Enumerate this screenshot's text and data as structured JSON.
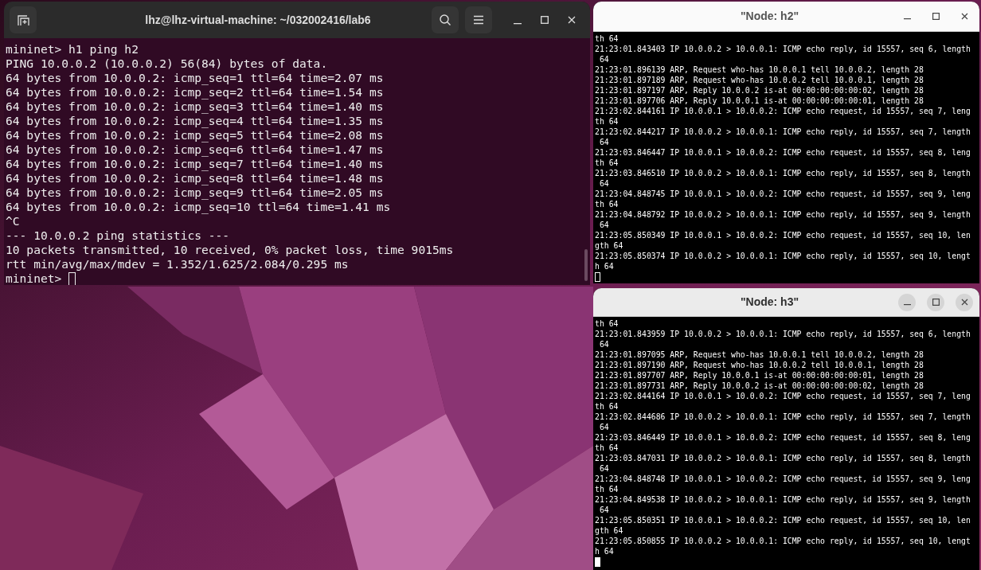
{
  "terminal": {
    "title": "lhz@lhz-virtual-machine: ~/032002416/lab6",
    "lines": [
      "mininet> h1 ping h2",
      "PING 10.0.0.2 (10.0.0.2) 56(84) bytes of data.",
      "64 bytes from 10.0.0.2: icmp_seq=1 ttl=64 time=2.07 ms",
      "64 bytes from 10.0.0.2: icmp_seq=2 ttl=64 time=1.54 ms",
      "64 bytes from 10.0.0.2: icmp_seq=3 ttl=64 time=1.40 ms",
      "64 bytes from 10.0.0.2: icmp_seq=4 ttl=64 time=1.35 ms",
      "64 bytes from 10.0.0.2: icmp_seq=5 ttl=64 time=2.08 ms",
      "64 bytes from 10.0.0.2: icmp_seq=6 ttl=64 time=1.47 ms",
      "64 bytes from 10.0.0.2: icmp_seq=7 ttl=64 time=1.40 ms",
      "64 bytes from 10.0.0.2: icmp_seq=8 ttl=64 time=1.48 ms",
      "64 bytes from 10.0.0.2: icmp_seq=9 ttl=64 time=2.05 ms",
      "64 bytes from 10.0.0.2: icmp_seq=10 ttl=64 time=1.41 ms",
      "^C",
      "--- 10.0.0.2 ping statistics ---",
      "10 packets transmitted, 10 received, 0% packet loss, time 9015ms",
      "rtt min/avg/max/mdev = 1.352/1.625/2.084/0.295 ms"
    ],
    "prompt": "mininet>"
  },
  "nodes": [
    {
      "title": "\"Node: h2\"",
      "focused": false,
      "lines": [
        "th 64",
        "21:23:01.843403 IP 10.0.0.2 > 10.0.0.1: ICMP echo reply, id 15557, seq 6, length",
        " 64",
        "21:23:01.896139 ARP, Request who-has 10.0.0.1 tell 10.0.0.2, length 28",
        "21:23:01.897189 ARP, Request who-has 10.0.0.2 tell 10.0.0.1, length 28",
        "21:23:01.897197 ARP, Reply 10.0.0.2 is-at 00:00:00:00:00:02, length 28",
        "21:23:01.897706 ARP, Reply 10.0.0.1 is-at 00:00:00:00:00:01, length 28",
        "21:23:02.844161 IP 10.0.0.1 > 10.0.0.2: ICMP echo request, id 15557, seq 7, leng",
        "th 64",
        "21:23:02.844217 IP 10.0.0.2 > 10.0.0.1: ICMP echo reply, id 15557, seq 7, length",
        " 64",
        "21:23:03.846447 IP 10.0.0.1 > 10.0.0.2: ICMP echo request, id 15557, seq 8, leng",
        "th 64",
        "21:23:03.846510 IP 10.0.0.2 > 10.0.0.1: ICMP echo reply, id 15557, seq 8, length",
        " 64",
        "21:23:04.848745 IP 10.0.0.1 > 10.0.0.2: ICMP echo request, id 15557, seq 9, leng",
        "th 64",
        "21:23:04.848792 IP 10.0.0.2 > 10.0.0.1: ICMP echo reply, id 15557, seq 9, length",
        " 64",
        "21:23:05.850349 IP 10.0.0.1 > 10.0.0.2: ICMP echo request, id 15557, seq 10, len",
        "gth 64",
        "21:23:05.850374 IP 10.0.0.2 > 10.0.0.1: ICMP echo reply, id 15557, seq 10, lengt",
        "h 64"
      ]
    },
    {
      "title": "\"Node: h3\"",
      "focused": true,
      "lines": [
        "th 64",
        "21:23:01.843959 IP 10.0.0.2 > 10.0.0.1: ICMP echo reply, id 15557, seq 6, length",
        " 64",
        "21:23:01.897095 ARP, Request who-has 10.0.0.1 tell 10.0.0.2, length 28",
        "21:23:01.897190 ARP, Request who-has 10.0.0.2 tell 10.0.0.1, length 28",
        "21:23:01.897707 ARP, Reply 10.0.0.1 is-at 00:00:00:00:00:01, length 28",
        "21:23:01.897731 ARP, Reply 10.0.0.2 is-at 00:00:00:00:00:02, length 28",
        "21:23:02.844164 IP 10.0.0.1 > 10.0.0.2: ICMP echo request, id 15557, seq 7, leng",
        "th 64",
        "21:23:02.844686 IP 10.0.0.2 > 10.0.0.1: ICMP echo reply, id 15557, seq 7, length",
        " 64",
        "21:23:03.846449 IP 10.0.0.1 > 10.0.0.2: ICMP echo request, id 15557, seq 8, leng",
        "th 64",
        "21:23:03.847031 IP 10.0.0.2 > 10.0.0.1: ICMP echo reply, id 15557, seq 8, length",
        " 64",
        "21:23:04.848748 IP 10.0.0.1 > 10.0.0.2: ICMP echo request, id 15557, seq 9, leng",
        "th 64",
        "21:23:04.849538 IP 10.0.0.2 > 10.0.0.1: ICMP echo reply, id 15557, seq 9, length",
        " 64",
        "21:23:05.850351 IP 10.0.0.1 > 10.0.0.2: ICMP echo request, id 15557, seq 10, len",
        "gth 64",
        "21:23:05.850855 IP 10.0.0.2 > 10.0.0.1: ICMP echo reply, id 15557, seq 10, lengt",
        "h 64"
      ]
    }
  ]
}
